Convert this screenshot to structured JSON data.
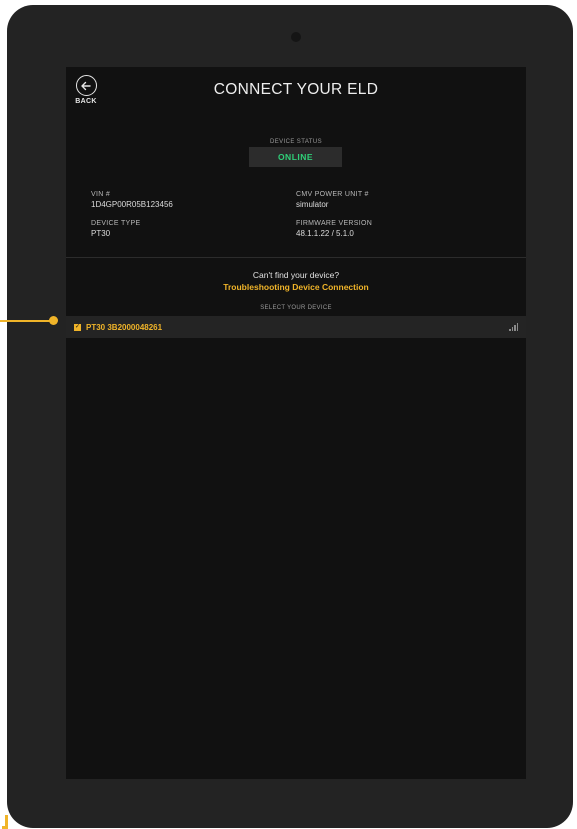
{
  "header": {
    "back_label": "BACK",
    "title": "CONNECT YOUR ELD"
  },
  "status": {
    "label": "DEVICE STATUS",
    "value": "ONLINE",
    "color": "#2fd078"
  },
  "info": {
    "vin_label": "VIN #",
    "vin_value": "1D4GP00R05B123456",
    "cmv_label": "CMV POWER UNIT #",
    "cmv_value": "simulator",
    "device_type_label": "DEVICE TYPE",
    "device_type_value": "PT30",
    "firmware_label": "FIRMWARE VERSION",
    "firmware_value": "48.1.1.22 / 5.1.0"
  },
  "help": {
    "cant_find": "Can't find your device?",
    "troubleshooting_link": "Troubleshooting Device Connection"
  },
  "device_list": {
    "label": "SELECT YOUR DEVICE",
    "devices": [
      {
        "name": "PT30 3B2000048261",
        "selected": true,
        "signal_icon": "signal-strength-icon"
      }
    ]
  },
  "colors": {
    "accent": "#f0b429",
    "screen_bg": "#111111",
    "device_frame": "#232323"
  }
}
